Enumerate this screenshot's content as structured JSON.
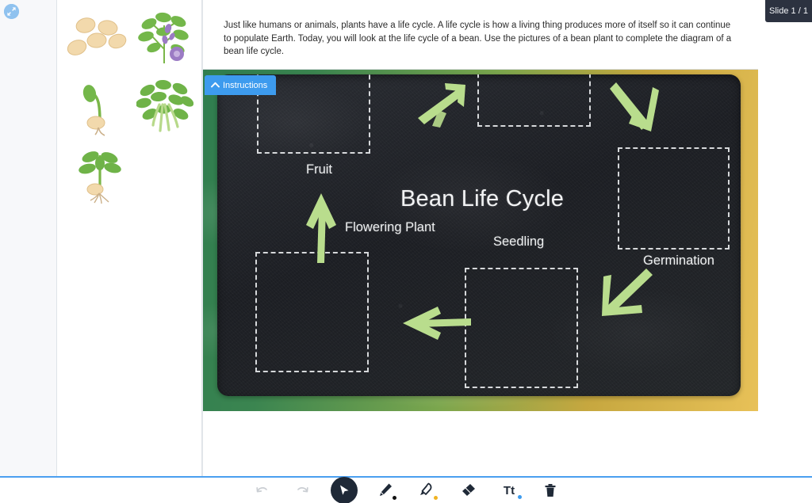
{
  "window": {
    "slide_counter": "Slide 1 / 1"
  },
  "left_rail": {
    "expand_icon": "expand-icon"
  },
  "assets": {
    "panel_name": "asset-panel",
    "items": [
      {
        "name": "bean-seeds-image",
        "alt": "Five bean seeds"
      },
      {
        "name": "flowering-plant-image",
        "alt": "Bean plant with purple flowers"
      },
      {
        "name": "germinating-seed-image",
        "alt": "Germinating bean seed with sprout and root"
      },
      {
        "name": "bean-fruit-plant-image",
        "alt": "Bean plant with green bean pods"
      },
      {
        "name": "seedling-image",
        "alt": "Young bean seedling with leaves and roots"
      }
    ]
  },
  "instructions": {
    "tab_label": "Instructions",
    "tab_icon": "chevron-up-icon",
    "body": "Just like humans or animals, plants have a life cycle. A life cycle is how a living thing produces more of itself so it can continue to populate Earth. Today, you will look at the life cycle of a bean. Use the pictures of a bean plant to complete the diagram of a bean life cycle."
  },
  "slide": {
    "title": "Bean Life Cycle",
    "labels": [
      {
        "name": "label-fruit",
        "text": "Fruit"
      },
      {
        "name": "label-flowering-plant",
        "text": "Flowering Plant"
      },
      {
        "name": "label-seedling",
        "text": "Seedling"
      },
      {
        "name": "label-germination",
        "text": "Germination"
      }
    ],
    "dropzones": [
      {
        "name": "dropzone-fruit"
      },
      {
        "name": "dropzone-seed"
      },
      {
        "name": "dropzone-germination"
      },
      {
        "name": "dropzone-flowering-plant"
      },
      {
        "name": "dropzone-seedling"
      }
    ],
    "arrows": [
      {
        "name": "arrow-seed-to-germination"
      },
      {
        "name": "arrow-germination-down"
      },
      {
        "name": "arrow-seedling-to-flowering"
      },
      {
        "name": "arrow-germination-to-seedling"
      },
      {
        "name": "arrow-flowering-to-fruit"
      }
    ],
    "colors": {
      "chalk_arrow": "#b9dd8d",
      "chalk_text": "#f0f2f3",
      "board": "#22252a",
      "frame_left": "#2f7d4f",
      "frame_right": "#e8c158",
      "accent": "#3d9bee"
    }
  },
  "toolbar": {
    "tools": [
      {
        "name": "undo-button",
        "icon": "undo-icon",
        "state": "disabled"
      },
      {
        "name": "redo-button",
        "icon": "redo-icon",
        "state": "disabled"
      },
      {
        "name": "select-tool",
        "icon": "cursor-icon",
        "state": "active"
      },
      {
        "name": "pen-tool",
        "icon": "pen-icon",
        "state": "normal",
        "dot_color": "#111111"
      },
      {
        "name": "highlighter-tool",
        "icon": "highlighter-icon",
        "state": "normal",
        "dot_color": "#f0b323"
      },
      {
        "name": "eraser-tool",
        "icon": "eraser-icon",
        "state": "normal"
      },
      {
        "name": "text-tool",
        "icon": "text-icon",
        "label": "Tt",
        "state": "normal",
        "dot_color": "#3d9bee"
      },
      {
        "name": "delete-tool",
        "icon": "trash-icon",
        "state": "normal"
      }
    ]
  }
}
